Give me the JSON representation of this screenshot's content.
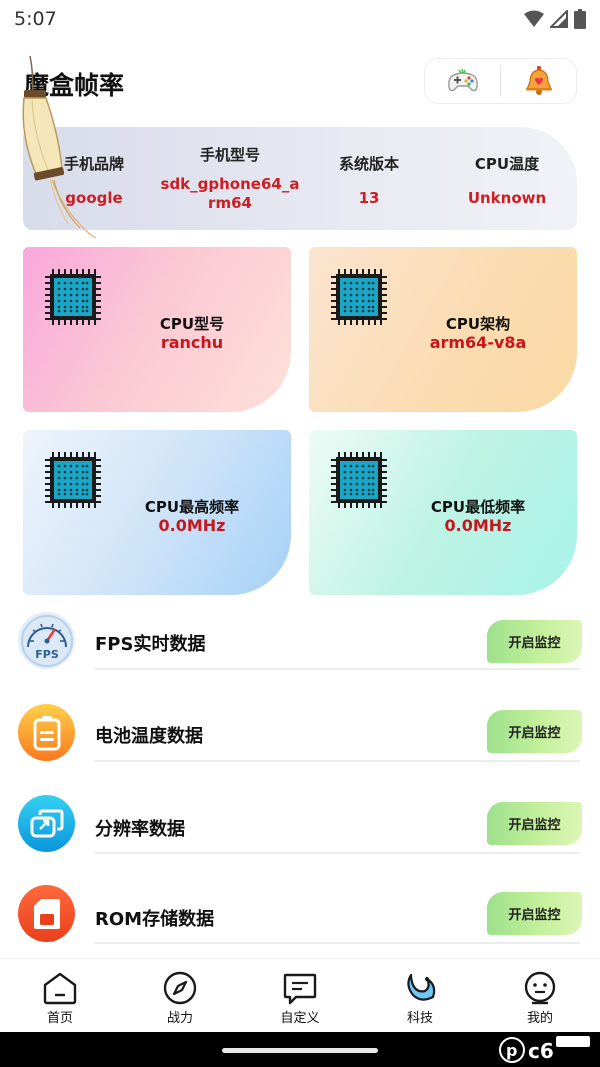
{
  "status_bar": {
    "time": "5:07"
  },
  "header": {
    "title": "魔盒帧率",
    "actions": [
      "gamepad-icon",
      "bell-icon"
    ]
  },
  "device_info": [
    {
      "label": "手机品牌",
      "value": "google"
    },
    {
      "label": "手机型号",
      "value": "sdk_gphone64_arm64"
    },
    {
      "label": "系统版本",
      "value": "13"
    },
    {
      "label": "CPU温度",
      "value": "Unknown"
    }
  ],
  "cards": [
    {
      "label": "CPU型号",
      "value": "ranchu"
    },
    {
      "label": "CPU架构",
      "value": "arm64-v8a"
    },
    {
      "label": "CPU最高频率",
      "value": "0.0MHz"
    },
    {
      "label": "CPU最低频率",
      "value": "0.0MHz"
    }
  ],
  "monitors": [
    {
      "title": "FPS实时数据",
      "button": "开启监控",
      "icon": "fps-gauge-icon"
    },
    {
      "title": "电池温度数据",
      "button": "开启监控",
      "icon": "battery-icon"
    },
    {
      "title": "分辨率数据",
      "button": "开启监控",
      "icon": "resolution-icon"
    },
    {
      "title": "ROM存储数据",
      "button": "开启监控",
      "icon": "sd-card-icon"
    }
  ],
  "bottom_nav": [
    {
      "label": "首页",
      "icon": "home-icon"
    },
    {
      "label": "战力",
      "icon": "compass-icon"
    },
    {
      "label": "自定义",
      "icon": "message-icon"
    },
    {
      "label": "科技",
      "icon": "moon-icon"
    },
    {
      "label": "我的",
      "icon": "profile-icon"
    }
  ],
  "colors": {
    "accent_red": "#cc1e24",
    "button_green": "#b5eb95"
  }
}
